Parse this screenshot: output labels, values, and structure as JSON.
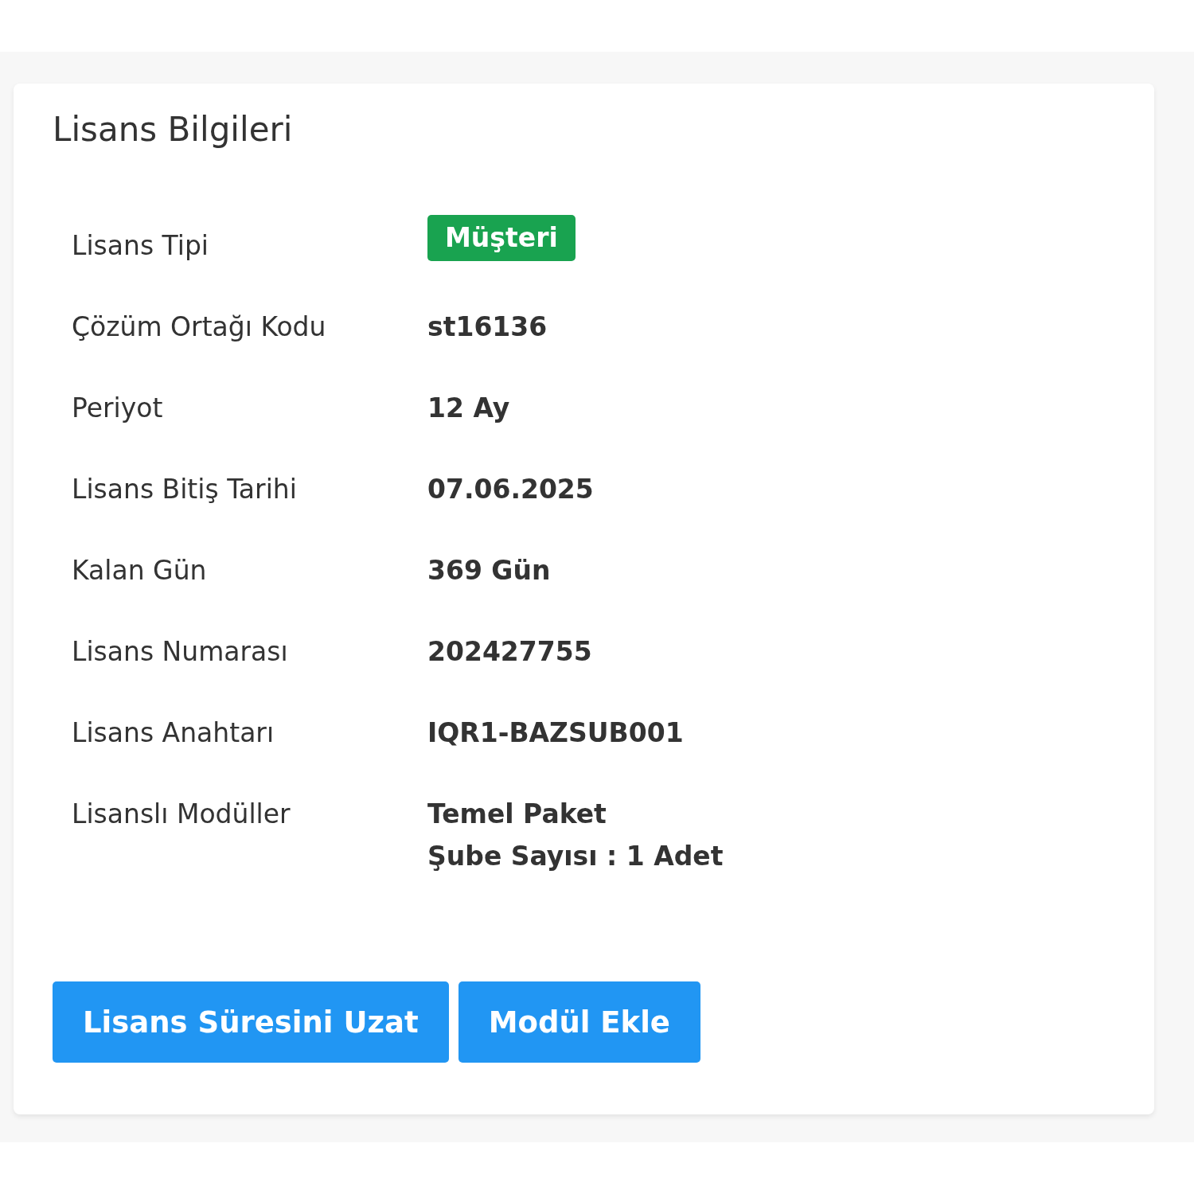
{
  "card": {
    "title": "Lisans Bilgileri"
  },
  "rows": [
    {
      "label": "Lisans Tipi",
      "kind": "badge",
      "values": [
        "Müşteri"
      ]
    },
    {
      "label": "Çözüm Ortağı Kodu",
      "kind": "text",
      "values": [
        "st16136"
      ]
    },
    {
      "label": "Periyot",
      "kind": "text",
      "values": [
        "12 Ay"
      ]
    },
    {
      "label": "Lisans Bitiş Tarihi",
      "kind": "text",
      "values": [
        "07.06.2025"
      ]
    },
    {
      "label": "Kalan Gün",
      "kind": "text",
      "values": [
        "369 Gün"
      ]
    },
    {
      "label": "Lisans Numarası",
      "kind": "text",
      "values": [
        "202427755"
      ]
    },
    {
      "label": "Lisans Anahtarı",
      "kind": "text",
      "values": [
        "IQR1-BAZSUB001"
      ]
    },
    {
      "label": "Lisanslı Modüller",
      "kind": "text",
      "values": [
        "Temel Paket",
        "Şube Sayısı : 1 Adet"
      ]
    }
  ],
  "buttons": [
    "Lisans Süresini Uzat",
    "Modül Ekle"
  ]
}
